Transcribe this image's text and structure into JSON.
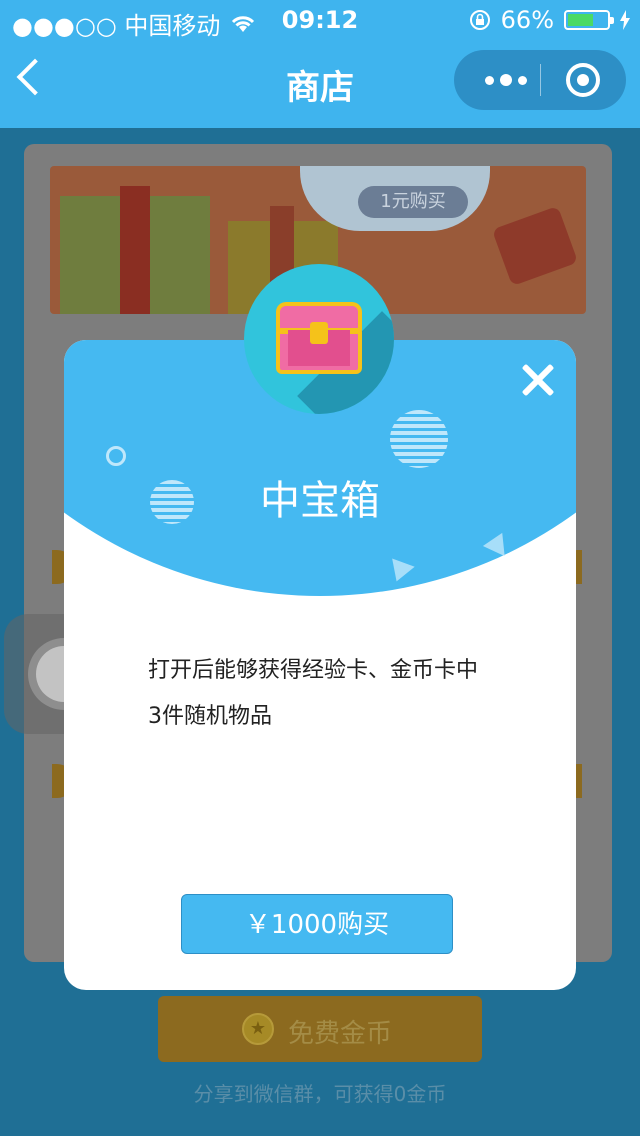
{
  "status_bar": {
    "carrier": "●●●○○ 中国移动",
    "time": "09:12",
    "battery_percent": "66%",
    "battery_level": 0.66,
    "icons": [
      "signal-dots-icon",
      "wifi-icon",
      "rotation-lock-icon",
      "battery-icon",
      "charging-icon"
    ]
  },
  "nav": {
    "title": "商店",
    "back_icon": "chevron-left-icon",
    "more_icon": "more-dots-icon",
    "close_mini_icon": "target-circle-icon"
  },
  "background": {
    "banner_buy_label": "1元购买",
    "free_coins_label": "免费金币",
    "free_coins_icon": "star-coin-icon",
    "share_tip": "分享到微信群，可获得0金币"
  },
  "modal": {
    "title": "中宝箱",
    "icon": "treasure-chest-icon",
    "close_icon": "close-icon",
    "description": "打开后能够获得经验卡、金币卡中3件随机物品",
    "buy_label": "￥1000购买"
  },
  "colors": {
    "accent": "#45b9f1",
    "nav_bg": "#3fb4ee",
    "coin_button": "#8c6a1f",
    "chest_pink": "#f06ca4",
    "chest_gold": "#f5c21a"
  }
}
